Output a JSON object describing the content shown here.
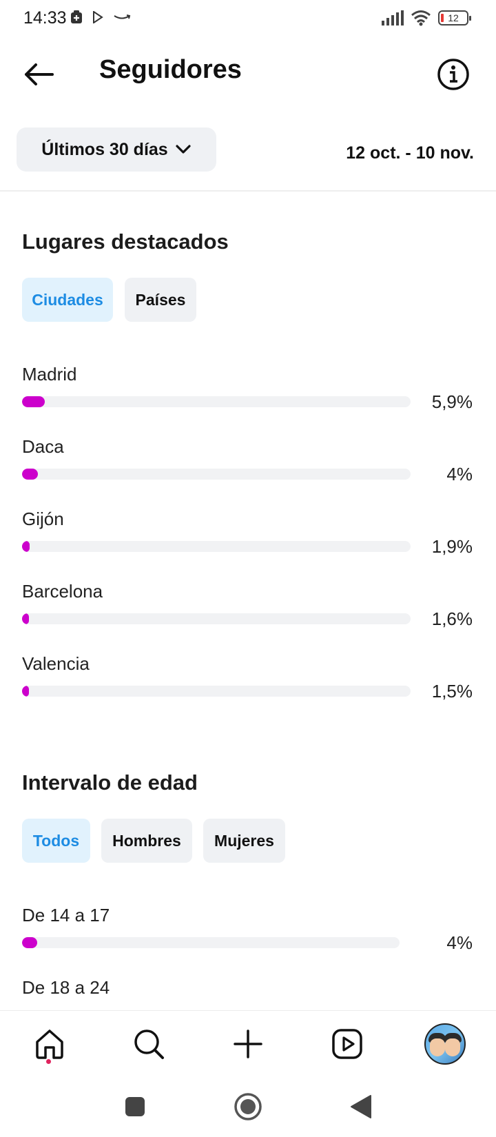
{
  "status_bar": {
    "time": "14:33",
    "battery": "12"
  },
  "header": {
    "title": "Seguidores"
  },
  "filter": {
    "range_label": "Últimos 30 días",
    "date_range": "12 oct. - 10 nov."
  },
  "places": {
    "title": "Lugares destacados",
    "tabs": [
      {
        "label": "Ciudades",
        "active": true
      },
      {
        "label": "Países",
        "active": false
      }
    ],
    "items": [
      {
        "name": "Madrid",
        "percent": "5,9%",
        "value": 5.9
      },
      {
        "name": "Daca",
        "percent": "4%",
        "value": 4
      },
      {
        "name": "Gijón",
        "percent": "1,9%",
        "value": 1.9
      },
      {
        "name": "Barcelona",
        "percent": "1,6%",
        "value": 1.6
      },
      {
        "name": "Valencia",
        "percent": "1,5%",
        "value": 1.5
      }
    ]
  },
  "age": {
    "title": "Intervalo de edad",
    "tabs": [
      {
        "label": "Todos",
        "active": true
      },
      {
        "label": "Hombres",
        "active": false
      },
      {
        "label": "Mujeres",
        "active": false
      }
    ],
    "items": [
      {
        "name": "De 14 a 17",
        "percent": "4%",
        "value": 4
      },
      {
        "name": "De 18 a 24"
      }
    ]
  },
  "colors": {
    "bar_fill": "#cc00cc",
    "bar_track": "#f1f2f4",
    "active_tab_bg": "#e1f2fd",
    "active_tab_text": "#1d8ce3",
    "notification_dot": "#e0245e"
  },
  "bottom_nav": {
    "items": [
      "home-icon",
      "search-icon",
      "create-icon",
      "reels-icon",
      "profile-avatar"
    ]
  }
}
